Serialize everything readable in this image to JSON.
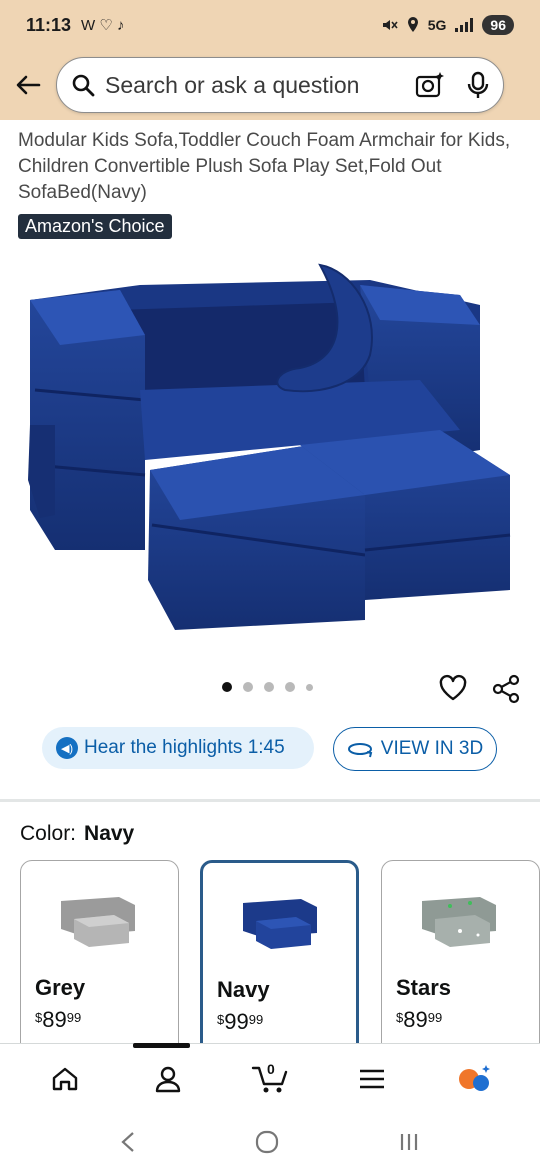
{
  "status_bar": {
    "time": "11:13",
    "left_icons": "W ♡ ♪",
    "network": "5G",
    "battery": "96"
  },
  "search": {
    "placeholder": "Search or ask a question"
  },
  "product": {
    "title": "Modular Kids Sofa,Toddler Couch Foam Armchair for Kids, Children Convertible Plush Sofa Play Set,Fold Out SofaBed(Navy)",
    "badge": "Amazon's Choice",
    "image_count": 5,
    "active_image": 1,
    "main_color": "#1c3a8a"
  },
  "actions": {
    "hear_label": "Hear the highlights 1:45",
    "view3d_label": "VIEW IN 3D"
  },
  "color_selector": {
    "label": "Color:",
    "selected": "Navy",
    "options": [
      {
        "name": "Grey",
        "currency": "$",
        "dollars": "89",
        "cents": "99",
        "swatch": "#9b9b9b"
      },
      {
        "name": "Navy",
        "currency": "$",
        "dollars": "99",
        "cents": "99",
        "swatch": "#1c3a8a"
      },
      {
        "name": "Stars",
        "currency": "$",
        "dollars": "89",
        "cents": "99",
        "swatch": "#8f9a95"
      }
    ]
  },
  "bottom_nav": {
    "cart_count": "0"
  },
  "colors": {
    "header_bg": "#efd5b4",
    "link_blue": "#0b5ea7",
    "accent_orange": "#f0762a"
  }
}
